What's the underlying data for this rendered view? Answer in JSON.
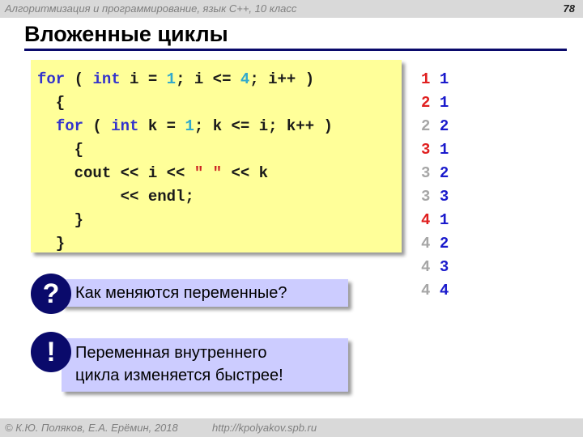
{
  "header": {
    "course": "Алгоритмизация и программирование, язык  C++, 10 класс",
    "page_number": "78"
  },
  "title": "Вложенные циклы",
  "code": {
    "lines": [
      [
        {
          "t": "for",
          "c": "kw"
        },
        {
          "t": " ( "
        },
        {
          "t": "int",
          "c": "kw"
        },
        {
          "t": " i = "
        },
        {
          "t": "1",
          "c": "num"
        },
        {
          "t": "; i <= "
        },
        {
          "t": "4",
          "c": "num"
        },
        {
          "t": "; i++ )"
        }
      ],
      [
        {
          "t": "  {"
        }
      ],
      [
        {
          "t": "  "
        },
        {
          "t": "for",
          "c": "kw"
        },
        {
          "t": " ( "
        },
        {
          "t": "int",
          "c": "kw"
        },
        {
          "t": " k = "
        },
        {
          "t": "1",
          "c": "num"
        },
        {
          "t": "; k <= i; k++ )"
        }
      ],
      [
        {
          "t": "    {"
        }
      ],
      [
        {
          "t": "    cout << i << "
        },
        {
          "t": "\" \"",
          "c": "str"
        },
        {
          "t": " << k"
        }
      ],
      [
        {
          "t": "         << endl;"
        }
      ],
      [
        {
          "t": "    }"
        }
      ],
      [
        {
          "t": "  }"
        }
      ]
    ]
  },
  "output": {
    "rows": [
      {
        "i": "1",
        "k": "1",
        "i_changed": true
      },
      {
        "i": "2",
        "k": "1",
        "i_changed": true
      },
      {
        "i": "2",
        "k": "2",
        "i_changed": false
      },
      {
        "i": "3",
        "k": "1",
        "i_changed": true
      },
      {
        "i": "3",
        "k": "2",
        "i_changed": false
      },
      {
        "i": "3",
        "k": "3",
        "i_changed": false
      },
      {
        "i": "4",
        "k": "1",
        "i_changed": true
      },
      {
        "i": "4",
        "k": "2",
        "i_changed": false
      },
      {
        "i": "4",
        "k": "3",
        "i_changed": false
      },
      {
        "i": "4",
        "k": "4",
        "i_changed": false
      }
    ]
  },
  "question": {
    "icon": "question-mark-icon",
    "symbol": "?",
    "text": "Как меняются переменные?"
  },
  "answer": {
    "icon": "exclamation-mark-icon",
    "symbol": "!",
    "line1": "Переменная внутреннего",
    "line2": "цикла изменяется быстрее!"
  },
  "footer": {
    "copyright": "© К.Ю. Поляков, Е.А. Ерёмин, 2018",
    "url": "http://kpolyakov.spb.ru"
  },
  "colors": {
    "code_background": "#ffff99",
    "callout_background": "#ccccff",
    "badge": "#0a0a6b",
    "keyword": "#3333cc",
    "number": "#33aacc",
    "string": "#cc2222",
    "i_changed": "#e02020",
    "i_same": "#a6a6a6",
    "k_value": "#1a1acc"
  }
}
